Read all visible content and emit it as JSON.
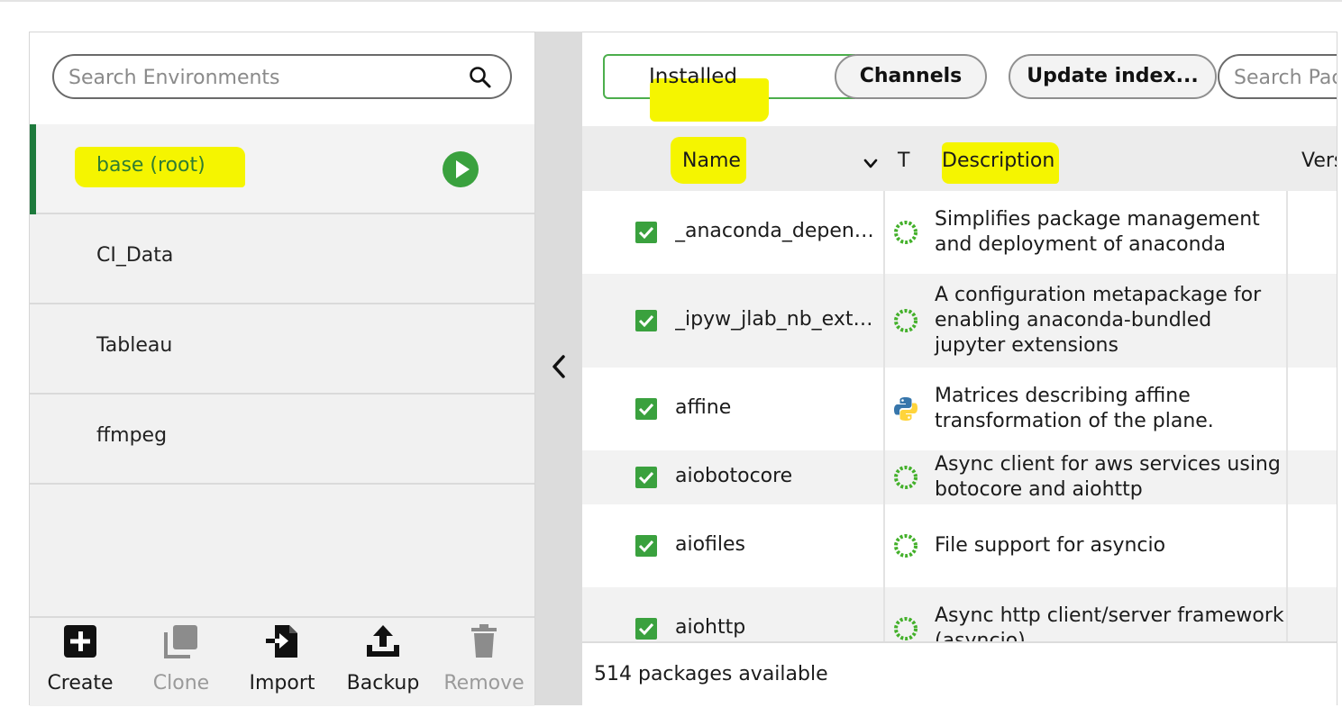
{
  "environments": {
    "search_placeholder": "Search Environments",
    "items": [
      {
        "label": "base (root)"
      },
      {
        "label": "CI_Data"
      },
      {
        "label": "Tableau"
      },
      {
        "label": "ffmpeg"
      }
    ],
    "actions": {
      "create": "Create",
      "clone": "Clone",
      "import": "Import",
      "backup": "Backup",
      "remove": "Remove"
    }
  },
  "packages": {
    "filter_selected": "Installed",
    "channels_label": "Channels",
    "update_index_label": "Update index...",
    "search_placeholder": "Search Packages",
    "columns": {
      "name": "Name",
      "type": "T",
      "description": "Description",
      "version": "Version"
    },
    "rows": [
      {
        "name": "_anaconda_depends",
        "type_icon": "conda-ring-icon",
        "description": "Simplifies package management and deployment of anaconda"
      },
      {
        "name": "_ipyw_jlab_nb_ext_conf",
        "type_icon": "conda-ring-icon",
        "description": "A configuration metapackage for enabling anaconda-bundled jupyter extensions"
      },
      {
        "name": "affine",
        "type_icon": "python-icon",
        "description": "Matrices describing affine transformation of the plane."
      },
      {
        "name": "aiobotocore",
        "type_icon": "conda-ring-icon",
        "description": "Async client for aws services using botocore and aiohttp"
      },
      {
        "name": "aiofiles",
        "type_icon": "conda-ring-icon",
        "description": "File support for asyncio"
      },
      {
        "name": "aiohttp",
        "type_icon": "conda-ring-icon",
        "description": "Async http client/server framework (asyncio)"
      }
    ],
    "status": "514 packages available"
  },
  "colors": {
    "accent_green": "#2f7d32",
    "checkbox_green": "#3aa13e",
    "highlight_yellow": "#f5f500"
  }
}
